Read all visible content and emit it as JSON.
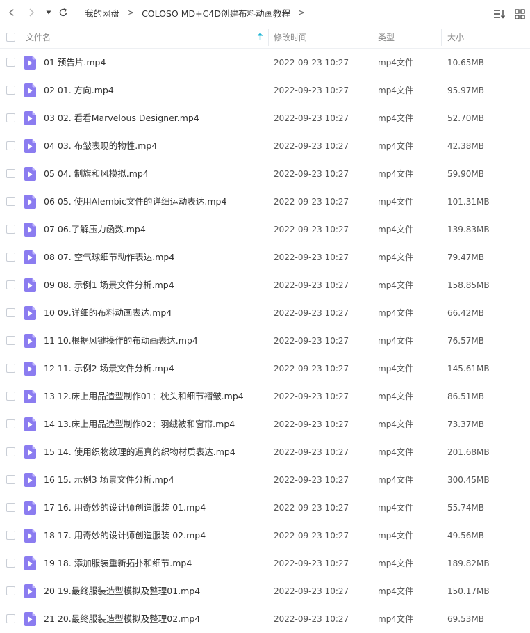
{
  "colors": {
    "accent": "#1eb5d5",
    "file_icon": "#8b7cf0",
    "file_icon_fold": "#c1b8ff"
  },
  "toolbar": {
    "back_icon": "chevron-left-icon",
    "forward_icon": "chevron-right-icon",
    "history_icon": "caret-down-icon",
    "refresh_icon": "refresh-icon",
    "sort_icon": "sort-list-icon",
    "view_icon": "grid-view-icon",
    "breadcrumb": [
      "我的网盘",
      "COLOSO MD+C4D创建布料动画教程"
    ],
    "separator": ">"
  },
  "columns": {
    "name": "文件名",
    "modified": "修改时间",
    "type": "类型",
    "size": "大小"
  },
  "files": [
    {
      "name": "01 预告片.mp4",
      "modified": "2022-09-23 10:27",
      "type": "mp4文件",
      "size": "10.65MB"
    },
    {
      "name": "02 01. 方向.mp4",
      "modified": "2022-09-23 10:27",
      "type": "mp4文件",
      "size": "95.97MB"
    },
    {
      "name": "03 02. 看看Marvelous Designer.mp4",
      "modified": "2022-09-23 10:27",
      "type": "mp4文件",
      "size": "52.70MB"
    },
    {
      "name": "04 03. 布皱表现的物性.mp4",
      "modified": "2022-09-23 10:27",
      "type": "mp4文件",
      "size": "42.38MB"
    },
    {
      "name": "05 04. 制旗和风模拟.mp4",
      "modified": "2022-09-23 10:27",
      "type": "mp4文件",
      "size": "59.90MB"
    },
    {
      "name": "06 05. 使用Alembic文件的详细运动表达.mp4",
      "modified": "2022-09-23 10:27",
      "type": "mp4文件",
      "size": "101.31MB"
    },
    {
      "name": "07 06.了解压力函数.mp4",
      "modified": "2022-09-23 10:27",
      "type": "mp4文件",
      "size": "139.83MB"
    },
    {
      "name": "08 07. 空气球细节动作表达.mp4",
      "modified": "2022-09-23 10:27",
      "type": "mp4文件",
      "size": "79.47MB"
    },
    {
      "name": "09 08. 示例1 场景文件分析.mp4",
      "modified": "2022-09-23 10:27",
      "type": "mp4文件",
      "size": "158.85MB"
    },
    {
      "name": "10 09.详细的布料动画表达.mp4",
      "modified": "2022-09-23 10:27",
      "type": "mp4文件",
      "size": "66.42MB"
    },
    {
      "name": "11 10.根据风键操作的布动画表达.mp4",
      "modified": "2022-09-23 10:27",
      "type": "mp4文件",
      "size": "76.57MB"
    },
    {
      "name": "12 11. 示例2 场景文件分析.mp4",
      "modified": "2022-09-23 10:27",
      "type": "mp4文件",
      "size": "145.61MB"
    },
    {
      "name": "13 12.床上用品造型制作01：枕头和细节褶皱.mp4",
      "modified": "2022-09-23 10:27",
      "type": "mp4文件",
      "size": "86.51MB"
    },
    {
      "name": "14 13.床上用品造型制作02：羽绒被和窗帘.mp4",
      "modified": "2022-09-23 10:27",
      "type": "mp4文件",
      "size": "73.37MB"
    },
    {
      "name": "15 14. 使用织物纹理的逼真的织物材质表达.mp4",
      "modified": "2022-09-23 10:27",
      "type": "mp4文件",
      "size": "201.68MB"
    },
    {
      "name": "16 15. 示例3 场景文件分析.mp4",
      "modified": "2022-09-23 10:27",
      "type": "mp4文件",
      "size": "300.45MB"
    },
    {
      "name": "17 16. 用奇妙的设计师创造服装 01.mp4",
      "modified": "2022-09-23 10:27",
      "type": "mp4文件",
      "size": "55.74MB"
    },
    {
      "name": "18 17. 用奇妙的设计师创造服装 02.mp4",
      "modified": "2022-09-23 10:27",
      "type": "mp4文件",
      "size": "49.56MB"
    },
    {
      "name": "19 18. 添加服装重新拓扑和细节.mp4",
      "modified": "2022-09-23 10:27",
      "type": "mp4文件",
      "size": "189.82MB"
    },
    {
      "name": "20 19.最终服装造型模拟及整理01.mp4",
      "modified": "2022-09-23 10:27",
      "type": "mp4文件",
      "size": "150.17MB"
    },
    {
      "name": "21 20.最终服装造型模拟及整理02.mp4",
      "modified": "2022-09-23 10:27",
      "type": "mp4文件",
      "size": "69.53MB"
    }
  ]
}
